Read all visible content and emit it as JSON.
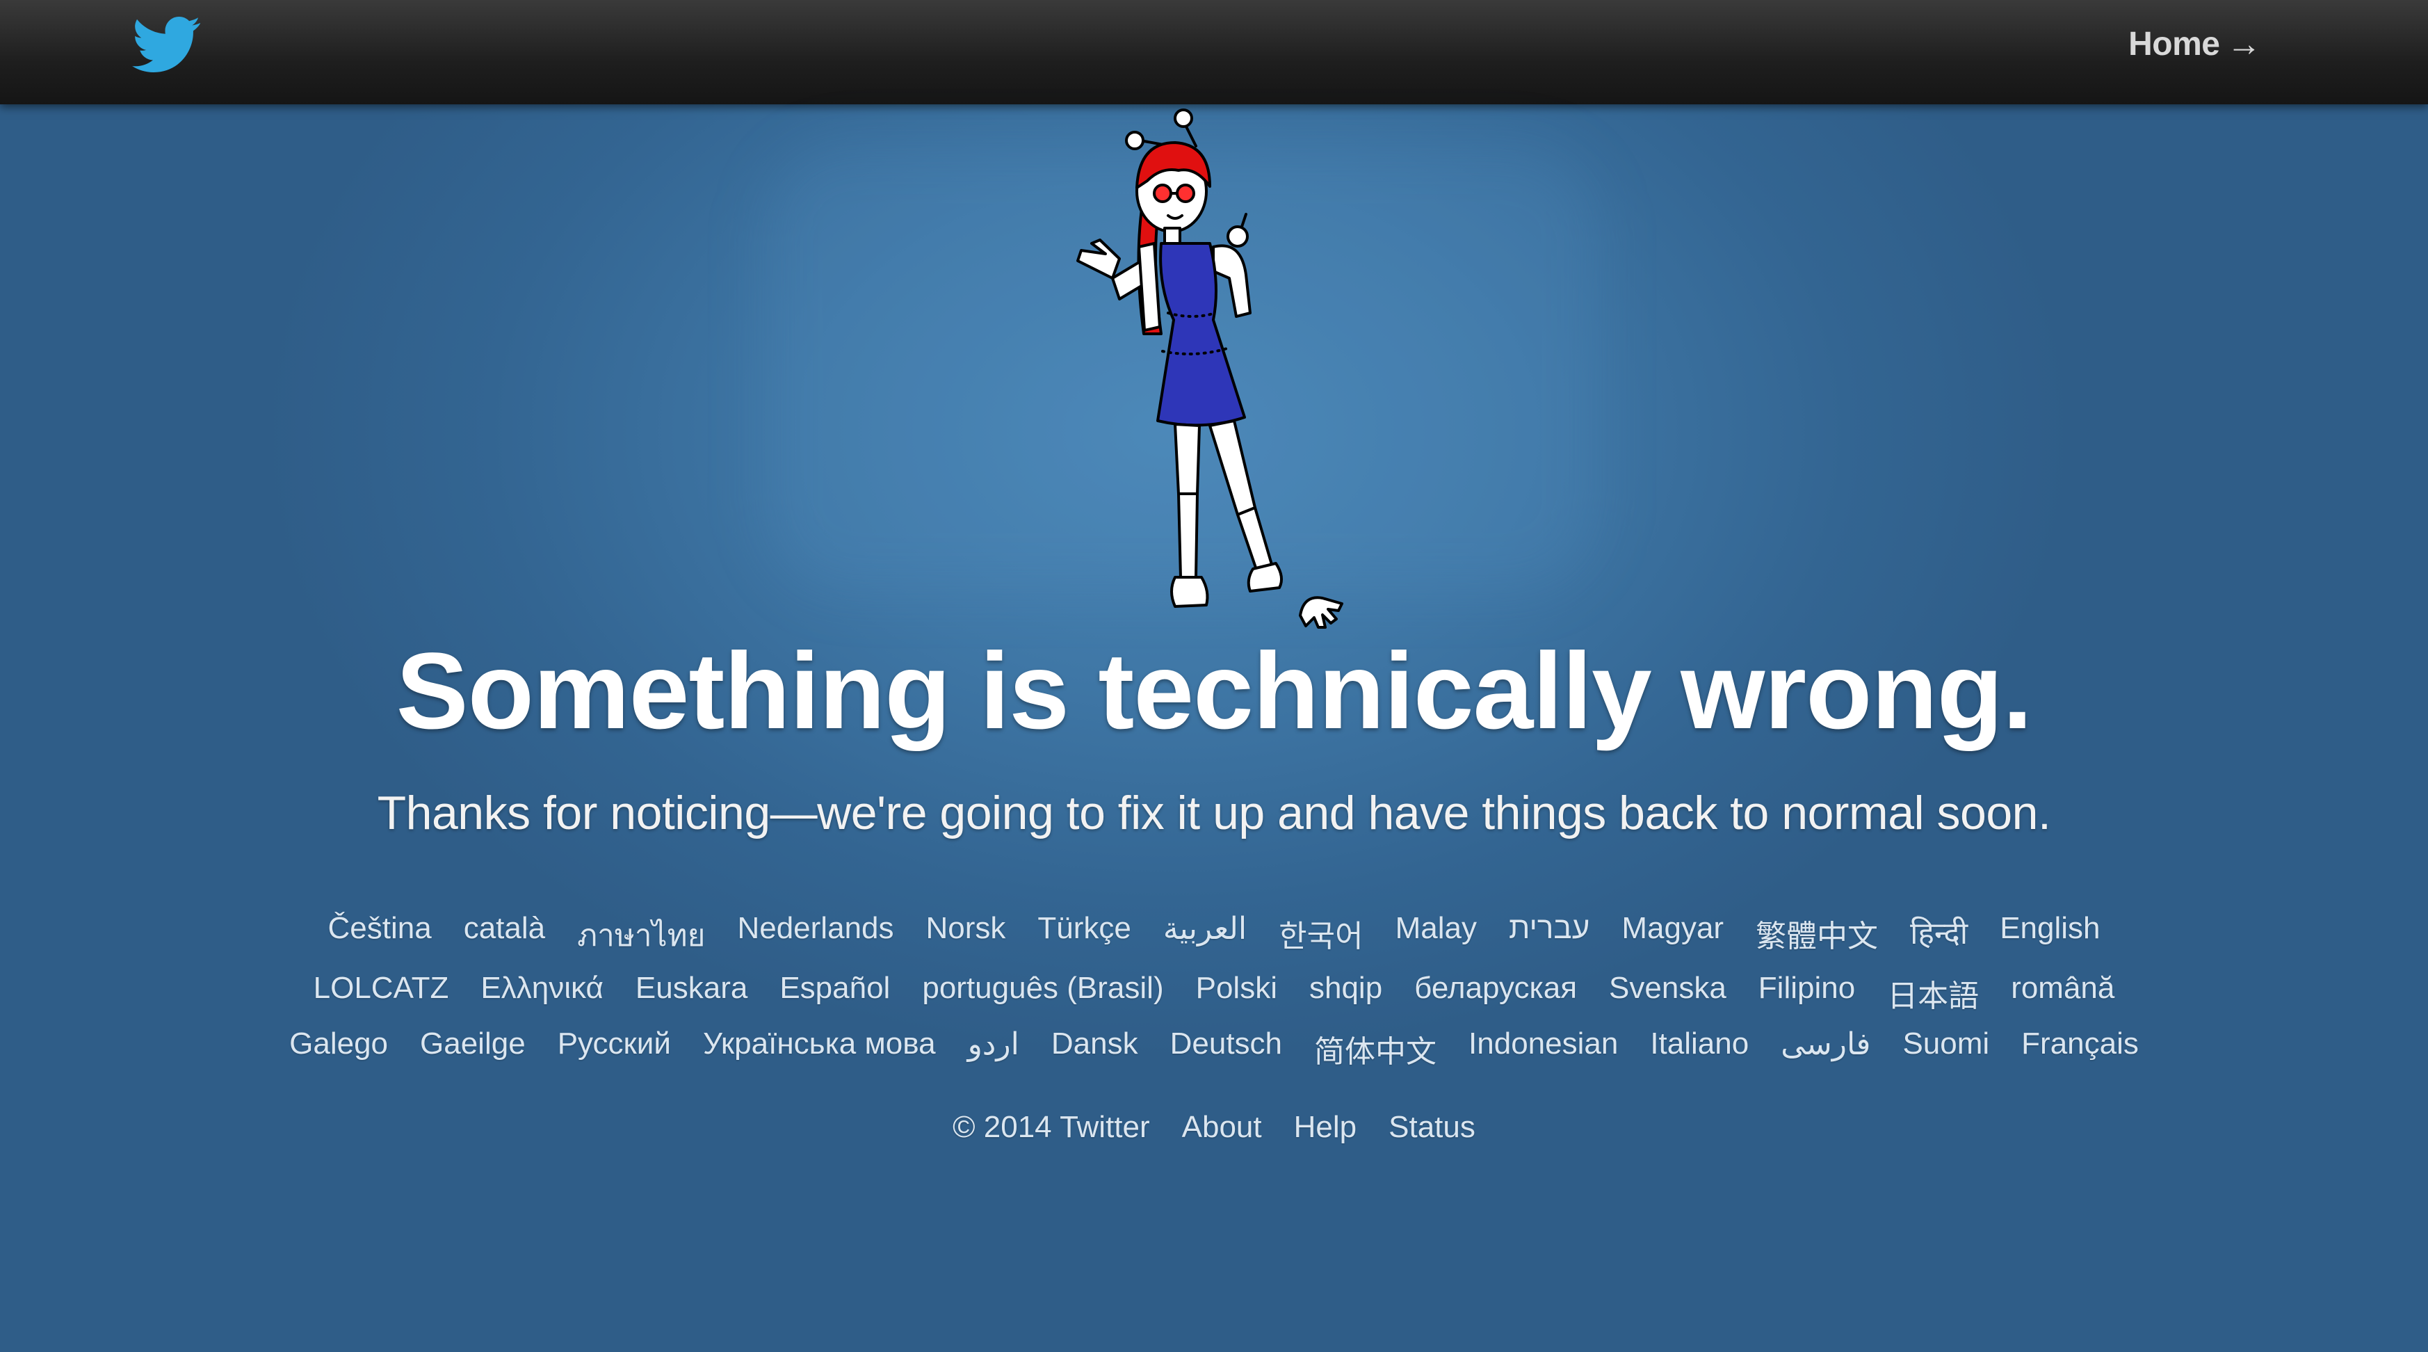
{
  "header": {
    "logo_icon": "twitter-bird-icon",
    "home_label": "Home",
    "home_arrow": "→"
  },
  "illustration": {
    "subject": "robot-girl-illustration",
    "hair_color": "#e01010",
    "dress_color": "#2e36b8"
  },
  "main": {
    "headline": "Something is technically wrong.",
    "subheadline": "Thanks for noticing—we're going to fix it up and have things back to normal soon."
  },
  "languages": {
    "row1": [
      "Čeština",
      "català",
      "ภาษาไทย",
      "Nederlands",
      "Norsk",
      "Türkçe",
      "العربية",
      "한국어",
      "Malay",
      "עברית",
      "Magyar",
      "繁體中文",
      "हिन्दी",
      "English"
    ],
    "row2": [
      "LOLCATZ",
      "Ελληνικά",
      "Euskara",
      "Español",
      "português (Brasil)",
      "Polski",
      "shqip",
      "беларуская",
      "Svenska",
      "Filipino",
      "日本語",
      "română"
    ],
    "row3": [
      "Galego",
      "Gaeilge",
      "Русский",
      "Українська мова",
      "اردو",
      "Dansk",
      "Deutsch",
      "简体中文",
      "Indonesian",
      "Italiano",
      "فارسی",
      "Suomi",
      "Français"
    ]
  },
  "footer": {
    "copyright": "© 2014 Twitter",
    "about": "About",
    "help": "Help",
    "status": "Status"
  },
  "colors": {
    "background": "#3f77a6",
    "topbar": "#1e1e1e",
    "logo": "#2fa8e0"
  }
}
